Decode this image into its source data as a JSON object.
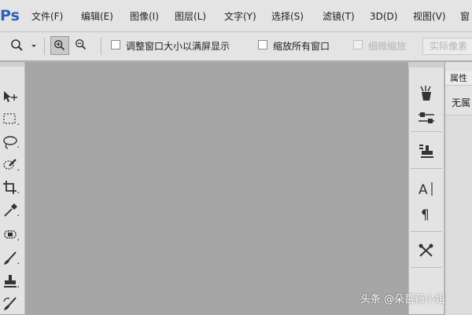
{
  "app": {
    "logo": "Ps",
    "accent": "#2b62b8",
    "workspace_color": "#a6a6a6"
  },
  "menubar": {
    "items": [
      "文件(F)",
      "编辑(E)",
      "图像(I)",
      "图层(L)",
      "文字(Y)",
      "选择(S)",
      "滤镜(T)",
      "3D(D)",
      "视图(V)",
      "窗"
    ]
  },
  "options_bar": {
    "zoom_tool_icon": "zoom-icon",
    "fit_window_label": "调整窗口大小以满屏显示",
    "zoom_all_label": "缩放所有窗口",
    "scrubby_zoom_label": "细微缩放",
    "actual_pixels_label": "实际像素"
  },
  "toolbar": {
    "tools": [
      "move-tool-icon",
      "marquee-tool-icon",
      "lasso-tool-icon",
      "quick-select-tool-icon",
      "crop-tool-icon",
      "eyedropper-tool-icon",
      "healing-brush-tool-icon",
      "brush-tool-icon",
      "clone-stamp-tool-icon",
      "history-brush-tool-icon"
    ]
  },
  "panel_strip": {
    "icons": [
      "history-panel-icon",
      "adjustments-panel-icon",
      "layers-panel-icon",
      "character-panel-icon",
      "paragraph-panel-icon",
      "tool-presets-panel-icon"
    ]
  },
  "properties_panel": {
    "tab_label": "属性",
    "value": "无属"
  },
  "watermark": {
    "text": "头条 @朵蔷薇小姐"
  }
}
